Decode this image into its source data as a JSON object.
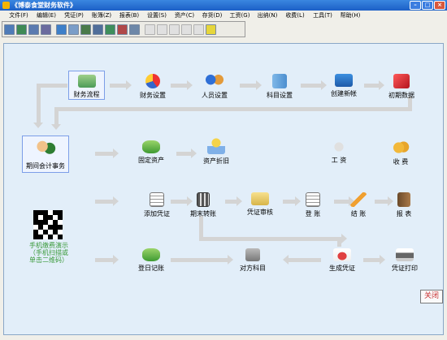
{
  "window": {
    "title": "《博泰食堂财务软件》",
    "close_label": "×"
  },
  "menu": [
    "文件(F)",
    "编辑(E)",
    "凭证(P)",
    "账簿(Z)",
    "报表(B)",
    "设置(S)",
    "资产(C)",
    "存货(D)",
    "工资(G)",
    "出纳(N)",
    "收费(L)",
    "工具(T)",
    "帮助(H)"
  ],
  "toolbar": {
    "icons": [
      "voucher-icon",
      "ledger-icon",
      "edit-icon",
      "tools-icon",
      "refresh-icon",
      "user-icon",
      "report-icon",
      "table-icon",
      "chart-icon",
      "book-icon",
      "print-icon",
      "save-icon",
      "pencil-icon",
      "cut-icon",
      "copy-icon",
      "paste-icon",
      "help-icon"
    ],
    "colors": [
      "#4f7bb8",
      "#3f8a55",
      "#5a7ab0",
      "#6b6b9e",
      "#3d7fc9",
      "#7a9dc8",
      "#4a7a4a",
      "#506e9a",
      "#3e8e5b",
      "#b04848",
      "#6d87a8",
      "#d0d0d0",
      "#d0d0d0",
      "#d0d0d0",
      "#d0d0d0",
      "#d0d0d0",
      "#e6d63c"
    ]
  },
  "flow": {
    "row1": [
      "财务流程",
      "财务设置",
      "人员设置",
      "科目设置",
      "创建新帐",
      "初期数据"
    ],
    "period": "期间会计事务",
    "row2": [
      "固定资产",
      "资产折旧",
      "工 资",
      "收 费"
    ],
    "row3": [
      "添加凭证",
      "期末转账",
      "凭证审核",
      "登 账",
      "结 账",
      "报 表"
    ],
    "row4": [
      "登日记账",
      "对方科目",
      "生成凭证",
      "凭证打印"
    ]
  },
  "promo": {
    "line1": "手机缴费演示",
    "line2": "（手机扫描或",
    "line3": "单击二维码）"
  },
  "close_button": "关闭",
  "colors": {
    "panel": "#e2eef9",
    "titlebar": "#1c5fc6",
    "arrow": "#d4d4d4",
    "promo": "#3a9a3a",
    "close_text": "#c83030"
  }
}
